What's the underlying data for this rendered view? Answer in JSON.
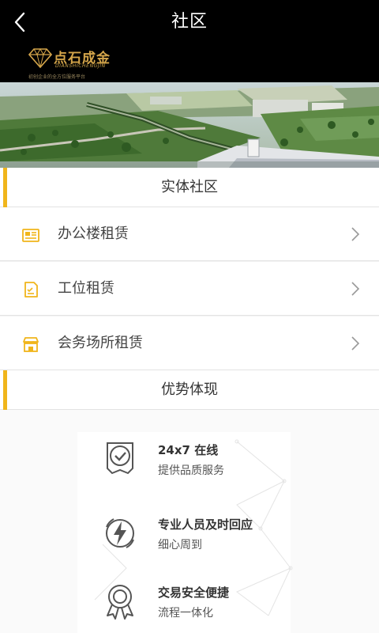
{
  "navbar": {
    "title": "社区",
    "back_icon": "chevron-left-icon"
  },
  "brand": {
    "name": "点石成金",
    "pinyin": "DIANSHICHENGJIN",
    "tagline": "初创企业的全方位服务平台",
    "logo_icon": "diamond-logo-icon"
  },
  "colors": {
    "accent": "#f0b51b",
    "header_bg": "#000000",
    "logo_gold": "#d4a54a"
  },
  "sections": {
    "physical": {
      "title": "实体社区",
      "items": [
        {
          "label": "办公楼租赁",
          "icon": "office-building-icon"
        },
        {
          "label": "工位租赁",
          "icon": "workstation-icon"
        },
        {
          "label": "会务场所租赁",
          "icon": "meeting-venue-icon"
        }
      ]
    },
    "advantages": {
      "title": "优势体现",
      "items": [
        {
          "title": "24x7 在线",
          "desc": "提供品质服务",
          "icon": "check-badge-icon"
        },
        {
          "title": "专业人员及时回应",
          "desc": "细心周到",
          "icon": "lightning-icon"
        },
        {
          "title": "交易安全便捷",
          "desc": "流程一体化",
          "icon": "award-ribbon-icon"
        }
      ]
    }
  }
}
